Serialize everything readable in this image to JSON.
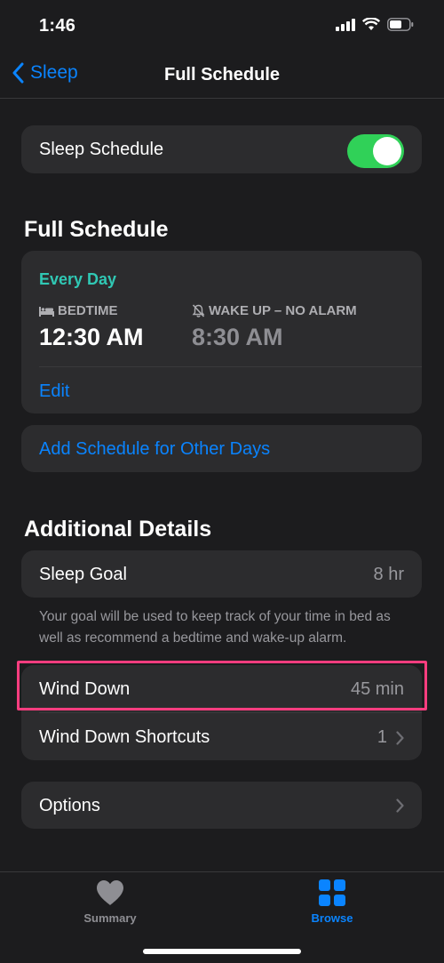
{
  "status": {
    "time": "1:46"
  },
  "nav": {
    "back_label": "Sleep",
    "title": "Full Schedule"
  },
  "sleep_schedule": {
    "label": "Sleep Schedule",
    "enabled": true
  },
  "full_schedule": {
    "heading": "Full Schedule",
    "days": "Every Day",
    "bedtime_label": "BEDTIME",
    "bedtime_value": "12:30 AM",
    "wake_label": "WAKE UP – NO ALARM",
    "wake_value": "8:30 AM",
    "edit_label": "Edit",
    "add_other_days": "Add Schedule for Other Days"
  },
  "additional": {
    "heading": "Additional Details",
    "sleep_goal_label": "Sleep Goal",
    "sleep_goal_value": "8 hr",
    "footnote": "Your goal will be used to keep track of your time in bed as well as recommend a bedtime and wake-up alarm.",
    "wind_down_label": "Wind Down",
    "wind_down_value": "45 min",
    "shortcuts_label": "Wind Down Shortcuts",
    "shortcuts_value": "1",
    "options_label": "Options"
  },
  "tabs": [
    {
      "label": "Summary",
      "icon": "heart-icon",
      "selected": false
    },
    {
      "label": "Browse",
      "icon": "grid-icon",
      "selected": true
    }
  ],
  "colors": {
    "accent": "#0a84ff",
    "toggle_on": "#30d158",
    "every_day": "#30c8b4",
    "highlight": "#ff3d7f",
    "background": "#1c1c1e",
    "card": "#2c2c2e"
  }
}
